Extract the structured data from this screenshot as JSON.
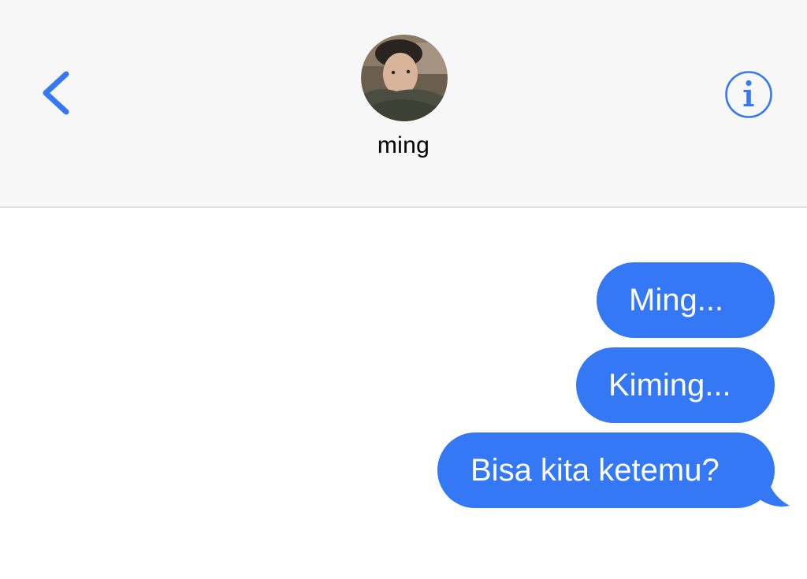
{
  "header": {
    "contact_name": "ming",
    "back_icon": "chevron-left-icon",
    "info_icon": "info-circle-icon",
    "accent_color": "#3478f6"
  },
  "messages": [
    {
      "direction": "outgoing",
      "text": "Ming..."
    },
    {
      "direction": "outgoing",
      "text": "Kiming..."
    },
    {
      "direction": "outgoing",
      "text": "Bisa kita ketemu?"
    }
  ]
}
